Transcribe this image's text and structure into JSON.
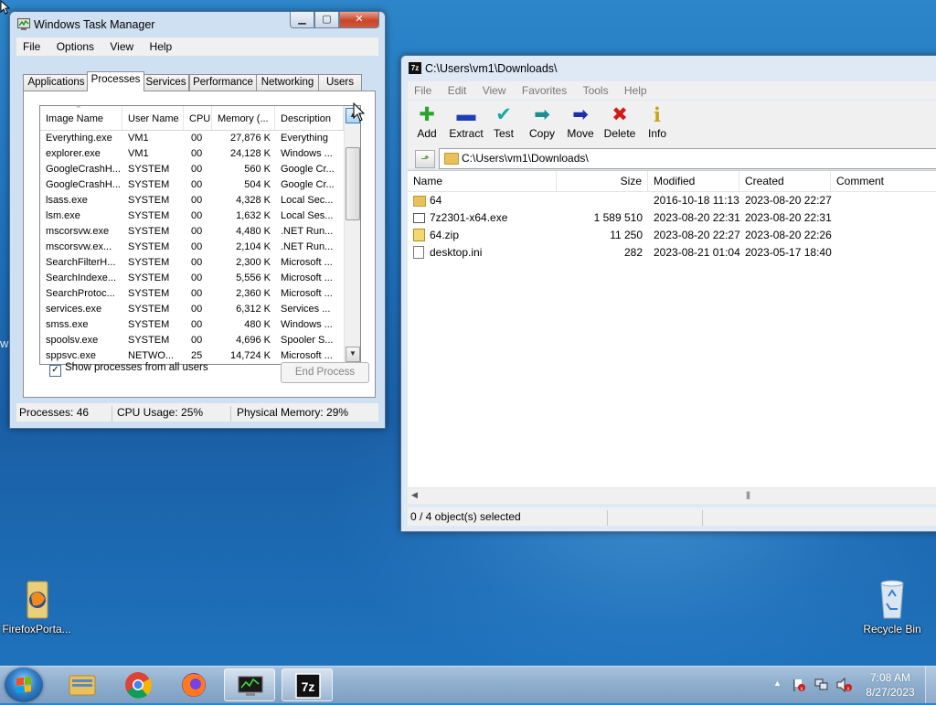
{
  "task_manager": {
    "title": "Windows Task Manager",
    "menu": [
      "File",
      "Options",
      "View",
      "Help"
    ],
    "tabs": [
      "Applications",
      "Processes",
      "Services",
      "Performance",
      "Networking",
      "Users"
    ],
    "active_tab": "Processes",
    "columns": [
      "Image Name",
      "User Name",
      "CPU",
      "Memory (...",
      "Description"
    ],
    "rows": [
      {
        "name": "Everything.exe",
        "user": "VM1",
        "cpu": "00",
        "mem": "27,876 K",
        "desc": "Everything"
      },
      {
        "name": "explorer.exe",
        "user": "VM1",
        "cpu": "00",
        "mem": "24,128 K",
        "desc": "Windows ..."
      },
      {
        "name": "GoogleCrashH...",
        "user": "SYSTEM",
        "cpu": "00",
        "mem": "560 K",
        "desc": "Google Cr..."
      },
      {
        "name": "GoogleCrashH...",
        "user": "SYSTEM",
        "cpu": "00",
        "mem": "504 K",
        "desc": "Google Cr..."
      },
      {
        "name": "lsass.exe",
        "user": "SYSTEM",
        "cpu": "00",
        "mem": "4,328 K",
        "desc": "Local Sec..."
      },
      {
        "name": "lsm.exe",
        "user": "SYSTEM",
        "cpu": "00",
        "mem": "1,632 K",
        "desc": "Local Ses..."
      },
      {
        "name": "mscorsvw.exe",
        "user": "SYSTEM",
        "cpu": "00",
        "mem": "4,480 K",
        "desc": ".NET Run..."
      },
      {
        "name": "mscorsvw.ex...",
        "user": "SYSTEM",
        "cpu": "00",
        "mem": "2,104 K",
        "desc": ".NET Run..."
      },
      {
        "name": "SearchFilterH...",
        "user": "SYSTEM",
        "cpu": "00",
        "mem": "2,300 K",
        "desc": "Microsoft ..."
      },
      {
        "name": "SearchIndexe...",
        "user": "SYSTEM",
        "cpu": "00",
        "mem": "5,556 K",
        "desc": "Microsoft ..."
      },
      {
        "name": "SearchProtoc...",
        "user": "SYSTEM",
        "cpu": "00",
        "mem": "2,360 K",
        "desc": "Microsoft ..."
      },
      {
        "name": "services.exe",
        "user": "SYSTEM",
        "cpu": "00",
        "mem": "6,312 K",
        "desc": "Services ..."
      },
      {
        "name": "smss.exe",
        "user": "SYSTEM",
        "cpu": "00",
        "mem": "480 K",
        "desc": "Windows ..."
      },
      {
        "name": "spoolsv.exe",
        "user": "SYSTEM",
        "cpu": "00",
        "mem": "4,696 K",
        "desc": "Spooler S..."
      },
      {
        "name": "sppsvc.exe",
        "user": "NETWO...",
        "cpu": "25",
        "mem": "14,724 K",
        "desc": "Microsoft ..."
      }
    ],
    "show_all_label": "Show processes from all users",
    "show_all_checked": true,
    "end_process_label": "End Process",
    "status": {
      "processes": "Processes: 46",
      "cpu": "CPU Usage: 25%",
      "memory": "Physical Memory: 29%"
    }
  },
  "file_manager": {
    "title": "C:\\Users\\vm1\\Downloads\\",
    "app_icon": "7z",
    "menu": [
      "File",
      "Edit",
      "View",
      "Favorites",
      "Tools",
      "Help"
    ],
    "toolbar": [
      {
        "label": "Add",
        "icon": "plus",
        "color": "#2aa52a"
      },
      {
        "label": "Extract",
        "icon": "minus",
        "color": "#1d3fb3"
      },
      {
        "label": "Test",
        "icon": "check-down",
        "color": "#1aa7a7"
      },
      {
        "label": "Copy",
        "icon": "arrow-right",
        "color": "#1a8f8f"
      },
      {
        "label": "Move",
        "icon": "arrow-right",
        "color": "#1d2fa8"
      },
      {
        "label": "Delete",
        "icon": "x",
        "color": "#d11a1a"
      },
      {
        "label": "Info",
        "icon": "i",
        "color": "#caa21a"
      }
    ],
    "path": "C:\\Users\\vm1\\Downloads\\",
    "columns": [
      "Name",
      "Size",
      "Modified",
      "Created",
      "Comment"
    ],
    "files": [
      {
        "name": "64",
        "type": "folder",
        "size": "",
        "modified": "2016-10-18 11:13",
        "created": "2023-08-20 22:27"
      },
      {
        "name": "7z2301-x64.exe",
        "type": "exe",
        "size": "1 589 510",
        "modified": "2023-08-20 22:31",
        "created": "2023-08-20 22:31"
      },
      {
        "name": "64.zip",
        "type": "zip",
        "size": "11 250",
        "modified": "2023-08-20 22:27",
        "created": "2023-08-20 22:26"
      },
      {
        "name": "desktop.ini",
        "type": "ini",
        "size": "282",
        "modified": "2023-08-21 01:04",
        "created": "2023-05-17 18:40"
      }
    ],
    "status": "0 / 4 object(s) selected"
  },
  "desktop": {
    "icons": [
      {
        "label": "FirefoxPorta...",
        "icon": "firefox-portable-folder-icon"
      },
      {
        "label": "Recycle Bin",
        "icon": "recycle-bin-icon"
      }
    ]
  },
  "taskbar": {
    "items": [
      "file-explorer",
      "chrome",
      "firefox",
      "task-manager",
      "7-zip"
    ],
    "active": [
      "task-manager",
      "7-zip"
    ],
    "time": "7:08 AM",
    "date": "8/27/2023"
  }
}
